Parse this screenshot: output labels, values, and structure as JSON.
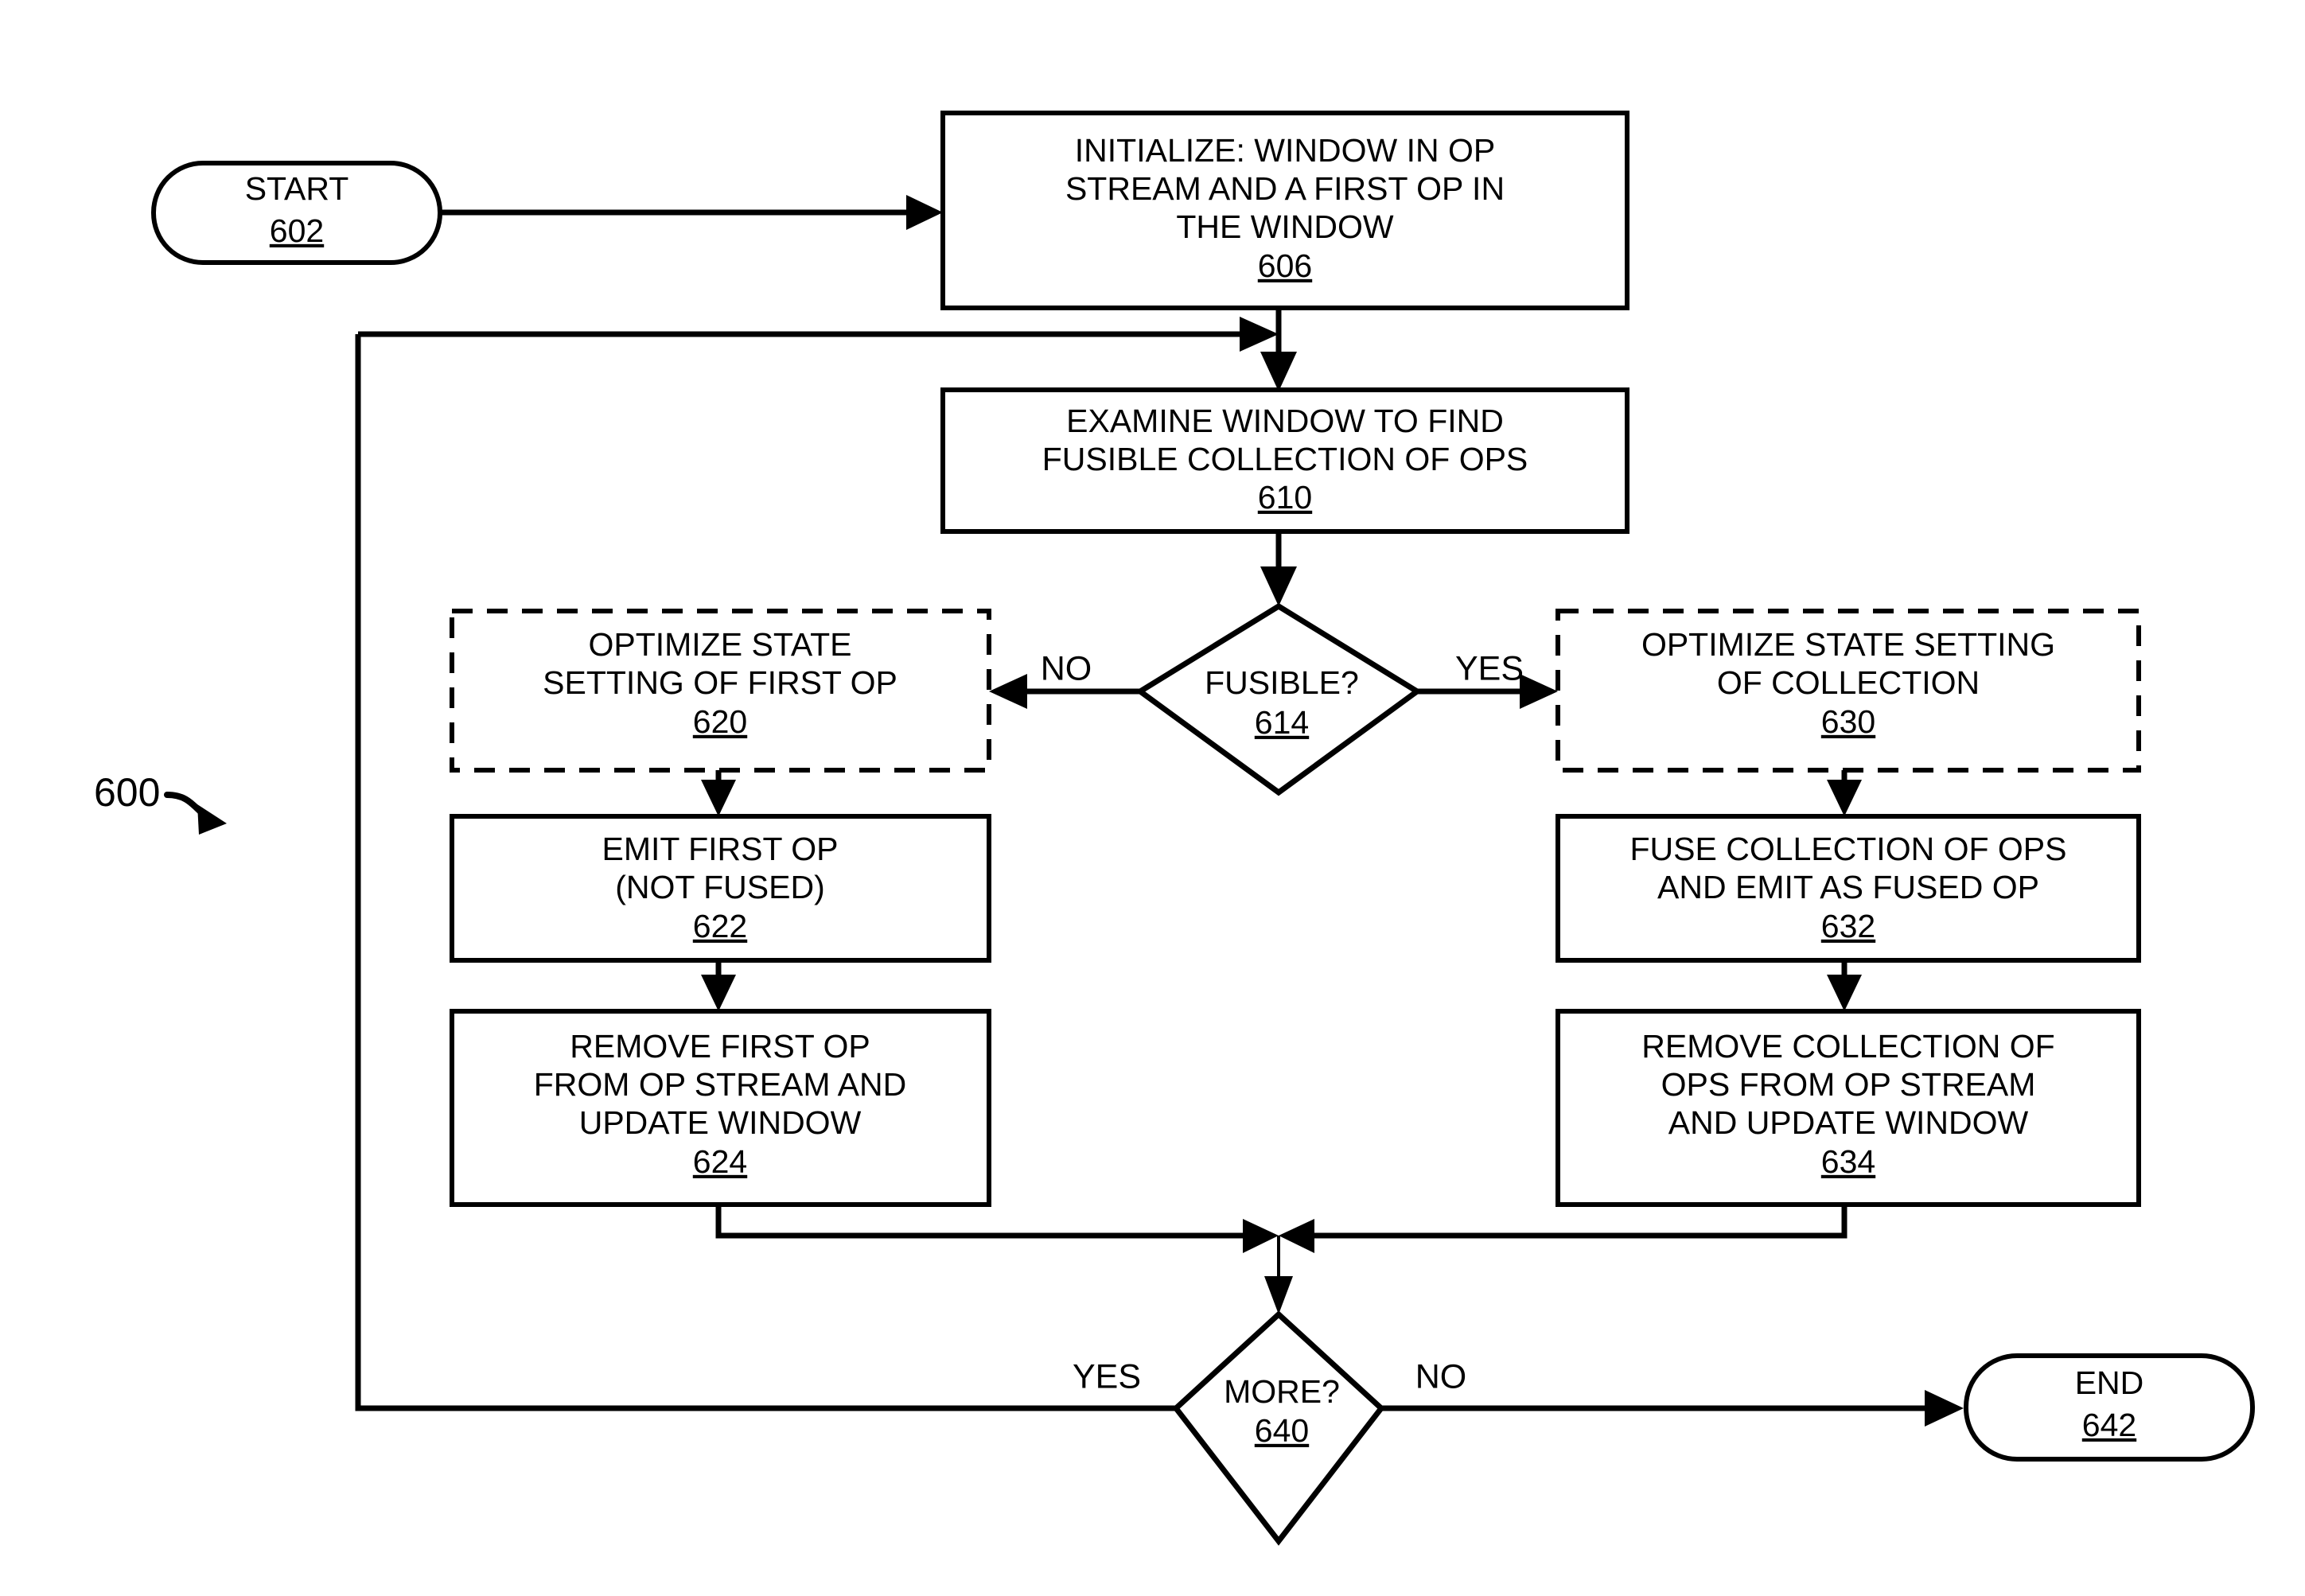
{
  "figure": {
    "label": "600",
    "nodes": {
      "start": {
        "title": "START",
        "ref": "602"
      },
      "initialize": {
        "line1": "INITIALIZE: WINDOW IN OP",
        "line2": "STREAM AND A FIRST OP IN",
        "line3": "THE WINDOW",
        "ref": "606"
      },
      "examine": {
        "line1": "EXAMINE WINDOW TO FIND",
        "line2": "FUSIBLE COLLECTION OF OPS",
        "ref": "610"
      },
      "fusible_decision": {
        "title": "FUSIBLE?",
        "ref": "614"
      },
      "optimize_first_op": {
        "line1": "OPTIMIZE STATE",
        "line2": "SETTING OF FIRST OP",
        "ref": "620"
      },
      "emit_first_op": {
        "line1": "EMIT FIRST OP",
        "line2": "(NOT FUSED)",
        "ref": "622"
      },
      "remove_first_op": {
        "line1": "REMOVE FIRST OP",
        "line2": "FROM OP STREAM AND",
        "line3": "UPDATE WINDOW",
        "ref": "624"
      },
      "optimize_collection": {
        "line1": "OPTIMIZE STATE SETTING",
        "line2": "OF COLLECTION",
        "ref": "630"
      },
      "fuse_collection": {
        "line1": "FUSE COLLECTION OF OPS",
        "line2": "AND EMIT AS FUSED OP",
        "ref": "632"
      },
      "remove_collection": {
        "line1": "REMOVE COLLECTION OF",
        "line2": "OPS FROM OP STREAM",
        "line3": "AND UPDATE WINDOW",
        "ref": "634"
      },
      "more_decision": {
        "title": "MORE?",
        "ref": "640"
      },
      "end": {
        "title": "END",
        "ref": "642"
      }
    },
    "edge_labels": {
      "fusible_no": "NO",
      "fusible_yes": "YES",
      "more_yes": "YES",
      "more_no": "NO"
    },
    "colors": {
      "stroke": "#000000",
      "fill": "#ffffff"
    }
  }
}
